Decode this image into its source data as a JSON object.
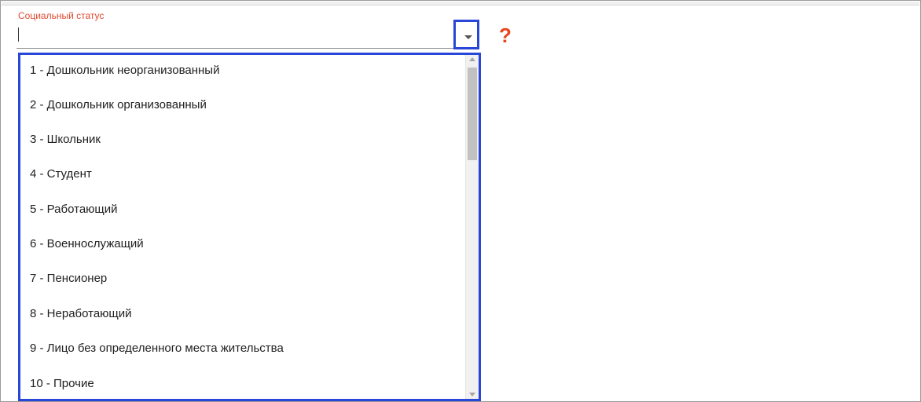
{
  "field": {
    "label": "Социальный статус",
    "value": "",
    "placeholder": ""
  },
  "help": {
    "glyph": "?"
  },
  "options": [
    "1 - Дошкольник неорганизованный",
    "2 - Дошкольник организованный",
    "3 - Школьник",
    "4 - Студент",
    "5 - Работающий",
    "6 - Военнослужащий",
    "7 - Пенсионер",
    "8 - Неработающий",
    "9 - Лицо без определенного места жительства",
    "10 - Прочие"
  ],
  "colors": {
    "label": "#e04a2f",
    "highlight_border": "#2846d8",
    "help_icon": "#e8451e"
  },
  "icons": {
    "dropdown": "chevron-down-icon",
    "help": "question-mark-icon"
  }
}
